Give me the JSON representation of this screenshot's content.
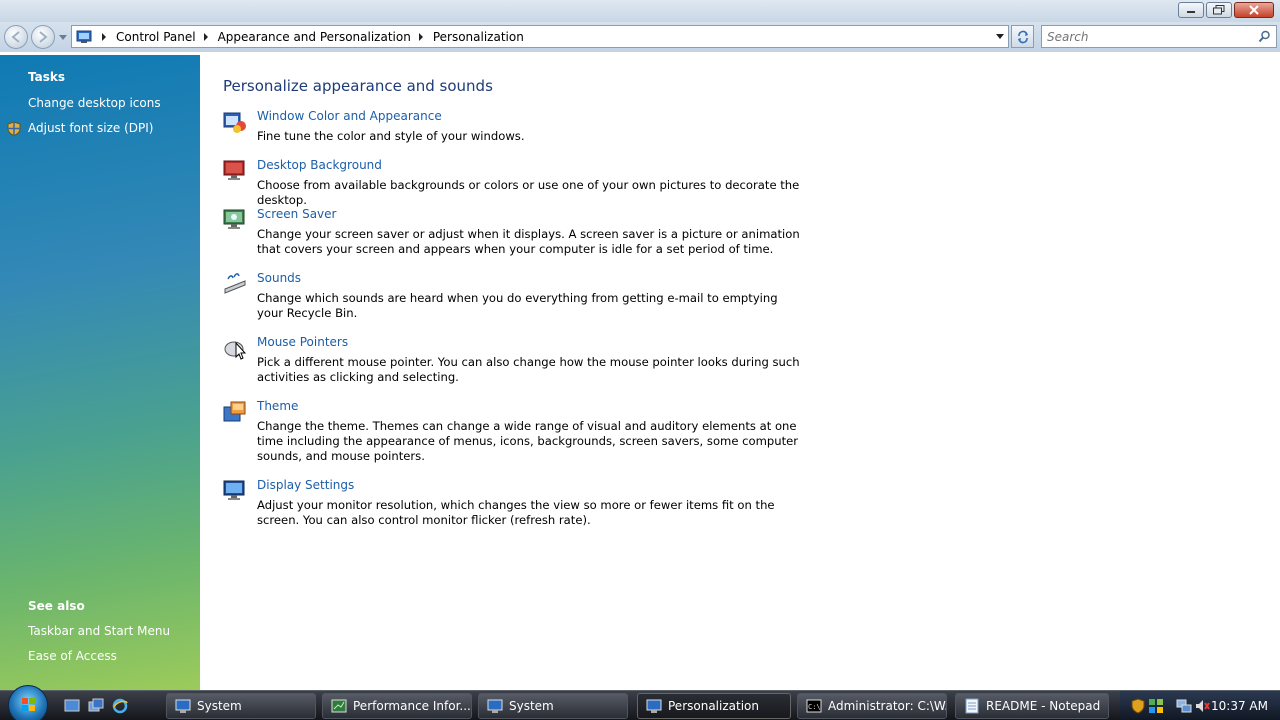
{
  "address_bar": {
    "breadcrumbs": [
      "Control Panel",
      "Appearance and Personalization",
      "Personalization"
    ],
    "search_placeholder": "Search"
  },
  "sidebar": {
    "tasks_title": "Tasks",
    "tasks": [
      "Change desktop icons",
      "Adjust font size (DPI)"
    ],
    "see_also_title": "See also",
    "see_also": [
      "Taskbar and Start Menu",
      "Ease of Access"
    ]
  },
  "main": {
    "heading": "Personalize appearance and sounds",
    "items": [
      {
        "title": "Window Color and Appearance",
        "description": "Fine tune the color and style of your windows.",
        "icon": "window-color-icon"
      },
      {
        "title": "Desktop Background",
        "description": "Choose from available backgrounds or colors or use one of your own pictures to decorate the desktop.",
        "icon": "desktop-background-icon"
      },
      {
        "title": "Screen Saver",
        "description": "Change your screen saver or adjust when it displays. A screen saver is a picture or animation that covers your screen and appears when your computer is idle for a set period of time.",
        "icon": "screen-saver-icon"
      },
      {
        "title": "Sounds",
        "description": "Change which sounds are heard when you do everything from getting e-mail to emptying your Recycle Bin.",
        "icon": "sounds-icon"
      },
      {
        "title": "Mouse Pointers",
        "description": "Pick a different mouse pointer. You can also change how the mouse pointer looks during such activities as clicking and selecting.",
        "icon": "mouse-pointers-icon"
      },
      {
        "title": "Theme",
        "description": "Change the theme. Themes can change a wide range of visual and auditory elements at one time including the appearance of menus, icons, backgrounds, screen savers, some computer sounds, and mouse pointers.",
        "icon": "theme-icon"
      },
      {
        "title": "Display Settings",
        "description": "Adjust your monitor resolution, which changes the view so more or fewer items fit on the screen. You can also control monitor flicker (refresh rate).",
        "icon": "display-settings-icon"
      }
    ]
  },
  "taskbar": {
    "buttons": [
      "System",
      "Performance Infor...",
      "System",
      "Personalization",
      "Administrator: C:\\W...",
      "README - Notepad"
    ],
    "active_index": 3,
    "clock": "10:37 AM"
  },
  "colors": {
    "link": "#1c5ea8",
    "heading": "#1e3c78",
    "sidebar_top": "#0f7ab3",
    "sidebar_bottom": "#9ccb5a"
  }
}
